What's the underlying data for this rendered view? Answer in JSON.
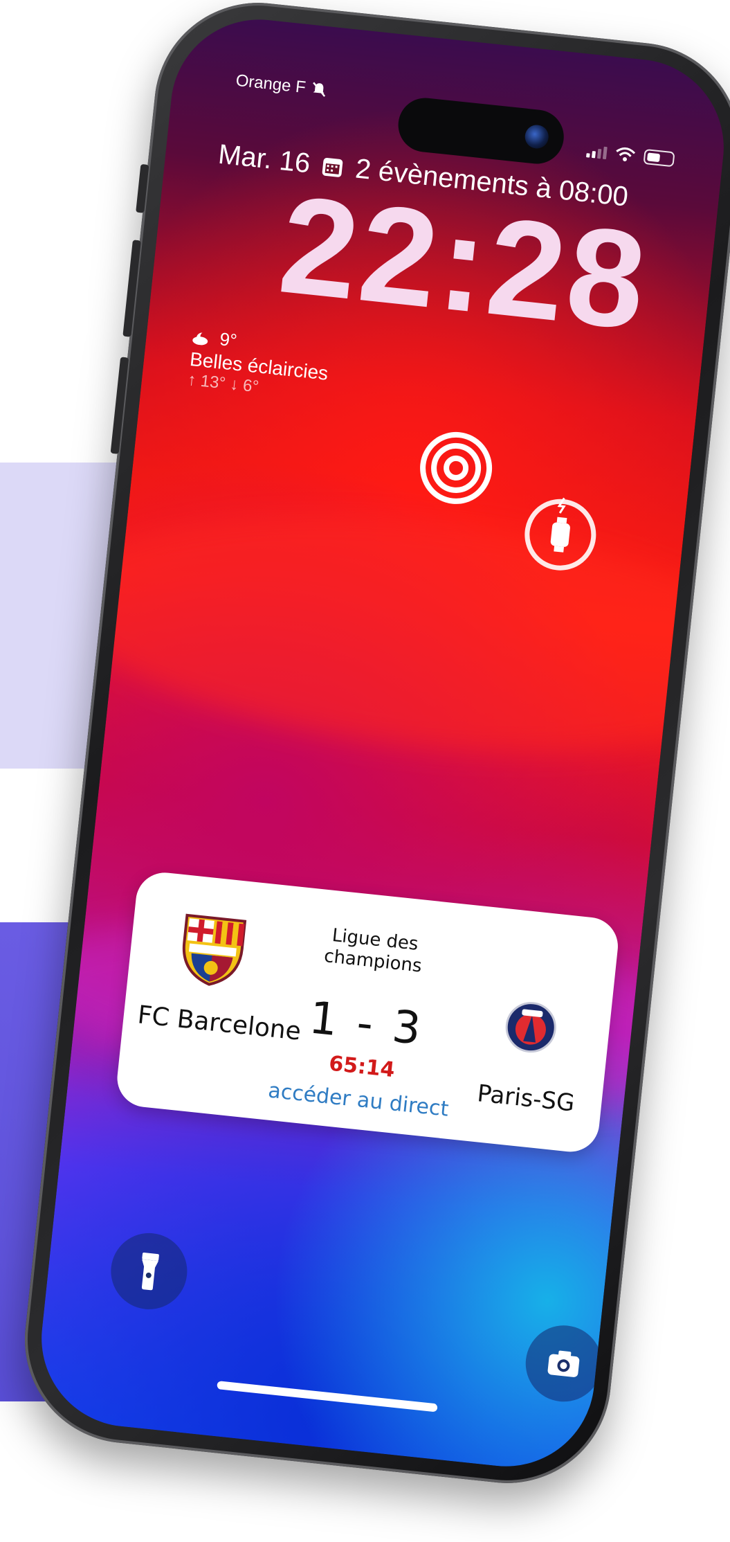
{
  "status_bar": {
    "carrier": "Orange F",
    "silent_icon": "bell-slash-icon",
    "signal_icon": "cellular-signal-icon",
    "wifi_icon": "wifi-icon",
    "battery_icon": "battery-icon",
    "battery_level": 0.5
  },
  "lock_screen": {
    "date": "Mar. 16",
    "calendar_icon": "calendar-icon",
    "events": "2 évènements à 08:00",
    "time": "22:28",
    "weather": {
      "icon": "partly-cloudy-night-icon",
      "temperature": "9°",
      "condition": "Belles éclaircies",
      "range": "↑ 13° ↓ 6°"
    },
    "widgets": [
      {
        "icon": "activity-rings-icon"
      },
      {
        "icon": "watch-battery-icon"
      }
    ]
  },
  "live_activity": {
    "home_team": "FC Barcelone",
    "home_crest": "fc-barcelona-crest-icon",
    "league": "Ligue des champions",
    "score": "1 - 3",
    "minute": "65:14",
    "link": "accéder au direct",
    "away_team": "Paris-SG",
    "away_crest": "paris-sg-crest-icon",
    "minute_color": "#d21a1a",
    "link_color": "#2f7cc3"
  },
  "bottom_controls": {
    "left_icon": "flashlight-icon",
    "right_icon": "camera-icon"
  },
  "colors": {
    "accent_light": "#dcd9f7",
    "accent_dark": "#5a4fd8"
  }
}
